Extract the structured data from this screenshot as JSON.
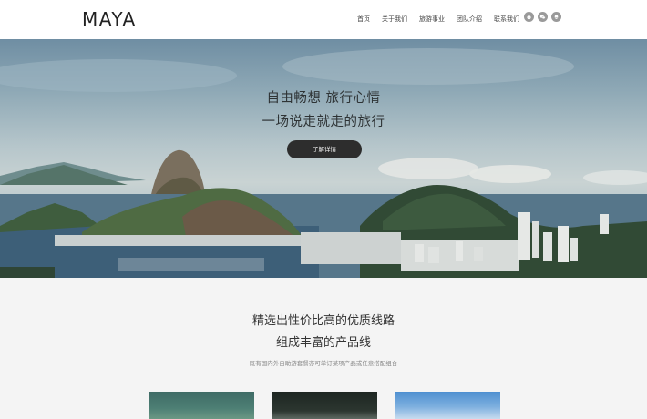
{
  "brand": {
    "logo": "MAYA"
  },
  "nav": {
    "items": [
      "首页",
      "关于我们",
      "旅游事业",
      "团队介绍",
      "联系我们"
    ]
  },
  "social": {
    "icons": [
      "weibo-icon",
      "wechat-icon",
      "qq-icon"
    ]
  },
  "hero": {
    "line1": "自由畅想 旅行心情",
    "line2": "一场说走就走的旅行",
    "button": "了解详情"
  },
  "section": {
    "title1": "精选出性价比高的优质线路",
    "title2": "组成丰富的产品线",
    "subtitle": "既有国内外自助游套餐亦可单订某项产品或任意搭配组合"
  },
  "colors": {
    "button_bg": "#2d2d2d",
    "header_bg": "#ffffff",
    "section_bg": "#f4f4f4"
  }
}
